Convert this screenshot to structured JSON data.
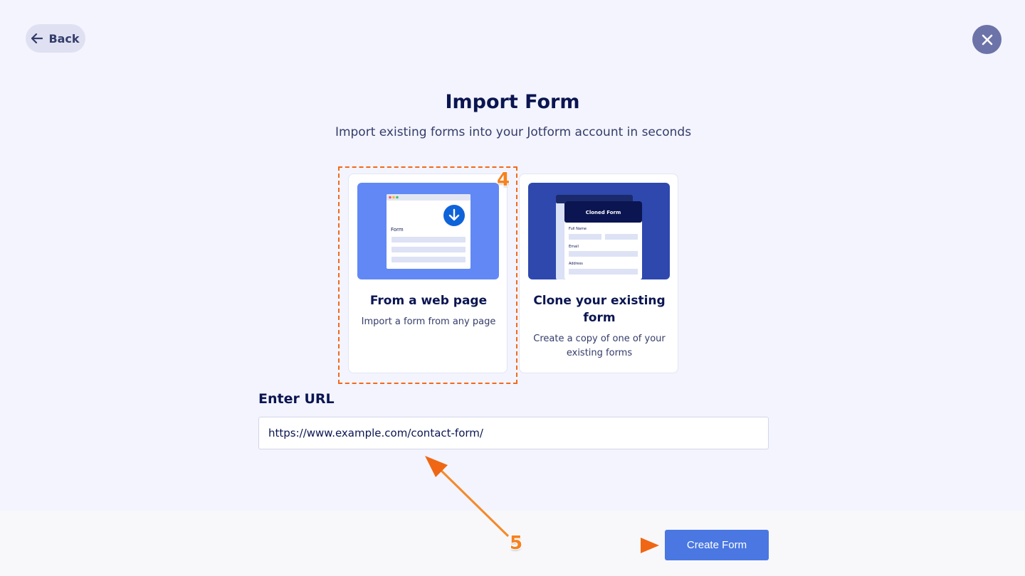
{
  "header": {
    "back_label": "Back"
  },
  "title": "Import Form",
  "subtitle": "Import existing forms into your Jotform account in seconds",
  "options": [
    {
      "title": "From a web page",
      "description": "Import a form from any page",
      "illustration_label": "Form"
    },
    {
      "title": "Clone your existing form",
      "description": "Create a copy of one of your existing forms",
      "illustration_labels": {
        "header": "Cloned Form",
        "full_name": "Full Name",
        "email": "Email",
        "address": "Address"
      }
    }
  ],
  "url_section": {
    "label": "Enter URL",
    "value": "https://www.example.com/contact-form/"
  },
  "footer": {
    "create_label": "Create Form"
  },
  "annotations": {
    "step_4": "4",
    "step_5": "5"
  },
  "colors": {
    "accent": "#4a77e2",
    "annotation": "#f26a1b",
    "text_dark": "#0a1551"
  },
  "icons": [
    "back-arrow-icon",
    "close-icon",
    "download-icon"
  ]
}
